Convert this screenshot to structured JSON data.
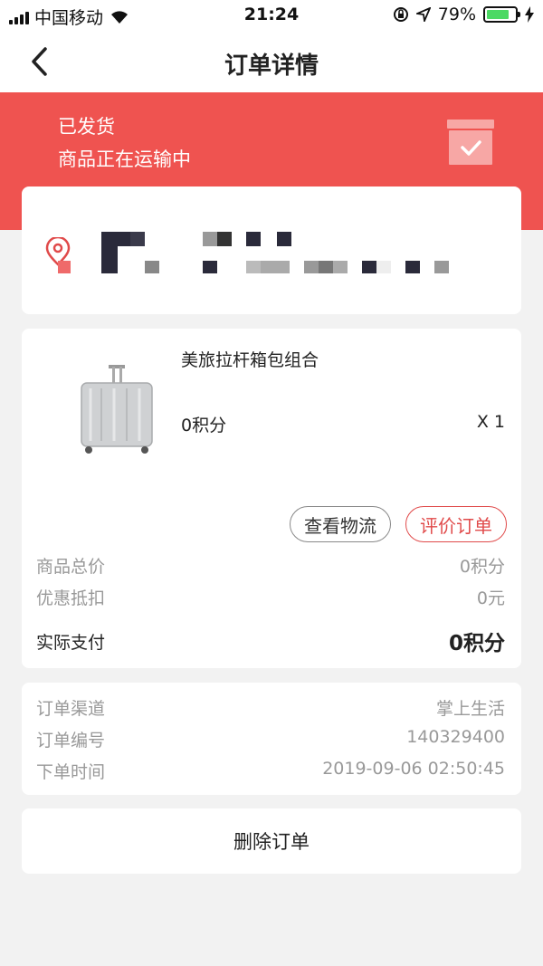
{
  "status_bar": {
    "carrier": "中国移动",
    "time": "21:24",
    "battery_percent": "79%",
    "battery_level": 0.79
  },
  "header": {
    "title": "订单详情"
  },
  "banner": {
    "status": "已发货",
    "subtitle": "商品正在运输中"
  },
  "goods": {
    "name": "美旅拉杆箱包组合",
    "price": "0积分",
    "quantity": "X 1",
    "buttons": {
      "logistics": "查看物流",
      "review": "评价订单"
    }
  },
  "price_summary": {
    "total_label": "商品总价",
    "total_value": "0积分",
    "discount_label": "优惠抵扣",
    "discount_value": "0元",
    "paid_label": "实际支付",
    "paid_value": "0积分"
  },
  "order_info": {
    "channel_label": "订单渠道",
    "channel_value": "掌上生活",
    "number_label": "订单编号",
    "number_value": "140329400",
    "time_label": "下单时间",
    "time_value": "2019-09-06 02:50:45"
  },
  "actions": {
    "delete": "删除订单"
  },
  "colors": {
    "brand_red": "#ef5350",
    "review_red": "#e04a4a",
    "battery_green": "#4cd964"
  }
}
